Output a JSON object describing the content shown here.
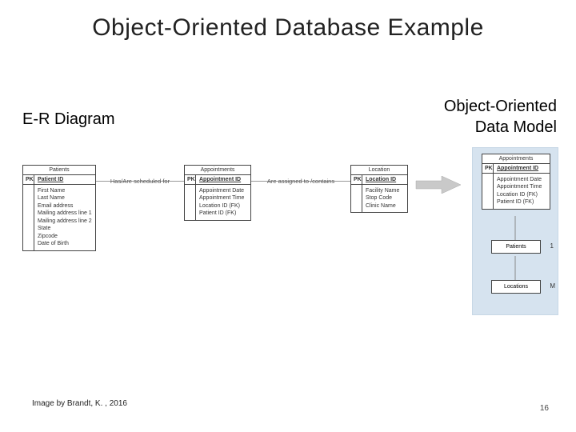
{
  "title": "Object-Oriented Database Example",
  "labels": {
    "left": "E-R Diagram",
    "right_line1": "Object-Oriented",
    "right_line2": "Data Model"
  },
  "entities": {
    "patients": {
      "title": "Patients",
      "pk_label": "PK",
      "pk_field": "Patient ID",
      "attrs": [
        "First Name",
        "Last Name",
        "Email address",
        "Mailing address line 1",
        "Mailing address line 2",
        "State",
        "Zipcode",
        "Date of Birth"
      ]
    },
    "appointments": {
      "title": "Appointments",
      "pk_label": "PK",
      "pk_field": "Appointment ID",
      "attrs": [
        "Appointment Date",
        "Appointment Time",
        "Location ID (FK)",
        "Patient ID (FK)"
      ]
    },
    "location": {
      "title": "Location",
      "pk_label": "PK",
      "pk_field": "Location ID",
      "attrs": [
        "Facility Name",
        "Stop Code",
        "Clinic Name"
      ]
    }
  },
  "relations": {
    "r1": "Has/Are scheduled for",
    "r2": "Are assigned to /contains"
  },
  "oo": {
    "appointments": {
      "title": "Appointments",
      "pk_label": "PK",
      "pk_field": "Appointment ID",
      "attrs": [
        "Appointment Date",
        "Appointment Time",
        "Location ID (FK)",
        "Patient ID (FK)"
      ]
    },
    "patients_box": "Patients",
    "locations_box": "Locations",
    "card1": "1",
    "cardM": "M"
  },
  "credit": "Image by Brandt, K. , 2016",
  "page": "16"
}
